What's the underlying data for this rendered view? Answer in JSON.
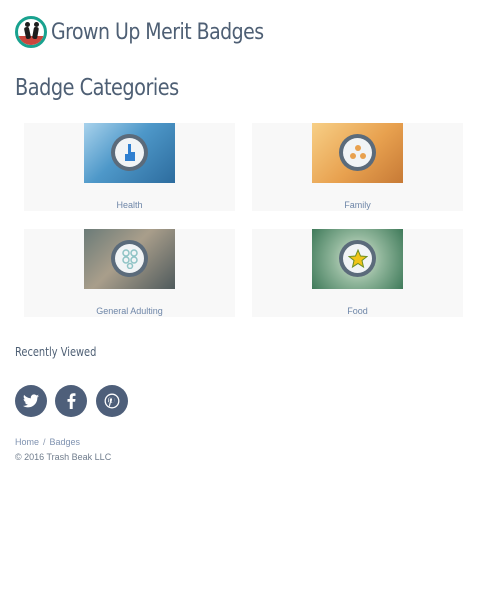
{
  "header": {
    "site_title": "Grown Up Merit Badges",
    "logo_icon": "group-people-icon"
  },
  "main": {
    "page_title": "Badge Categories",
    "categories": [
      {
        "label": "Health",
        "icon": "pointing-hand-icon",
        "accent": "#2f7fd0"
      },
      {
        "label": "Family",
        "icon": "family-icon",
        "accent": "#e8a14f"
      },
      {
        "label": "General Adulting",
        "icon": "coins-icon",
        "accent": "#8fc3c5"
      },
      {
        "label": "Food",
        "icon": "star-food-icon",
        "accent": "#f0c419"
      }
    ],
    "recently_viewed_title": "Recently Viewed"
  },
  "social": [
    {
      "name": "twitter",
      "icon": "twitter-icon",
      "glyph": "t"
    },
    {
      "name": "facebook",
      "icon": "facebook-icon",
      "glyph": "f"
    },
    {
      "name": "pinterest",
      "icon": "pinterest-icon",
      "glyph": "p"
    }
  ],
  "footer": {
    "breadcrumb": [
      "Home",
      "Badges"
    ],
    "breadcrumb_separator": "/",
    "copyright": "© 2016 Trash Beak LLC"
  },
  "colors": {
    "heading": "#4e5f74",
    "link": "#6e86a8",
    "social_bg": "#4e5f7a",
    "card_bg": "#f8f8f8",
    "logo_ring": "#19a28f"
  }
}
